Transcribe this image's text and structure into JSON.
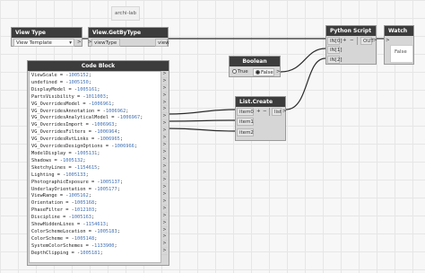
{
  "canvas_tag": "archi-lab",
  "nodes": {
    "view_type": {
      "title": "View Type",
      "value": "View Template",
      "dropdown_glyph": "▾",
      "out_glyph": ">"
    },
    "get_by_type": {
      "title": "View.GetByType",
      "in_port": "viewType",
      "out_port": "view",
      "in_glyph": ">"
    },
    "python": {
      "title": "Python Script",
      "in0": "IN[0]",
      "in1": "IN[1]",
      "in2": "IN[2]",
      "out": "OUT",
      "plus": "+",
      "minus": "−",
      "out_glyph": ">"
    },
    "watch": {
      "title": "Watch",
      "value": "False",
      "in_glyph": ">"
    },
    "boolean": {
      "title": "Boolean",
      "true_label": "True",
      "false_label": "False",
      "out_glyph": ">"
    },
    "list_create": {
      "title": "List.Create",
      "item0": "item0",
      "item1": "item1",
      "item2": "item2",
      "out": "list",
      "plus": "+",
      "minus": "−",
      "out_glyph": ">"
    },
    "code_block": {
      "title": "Code Block",
      "out_glyph": ">"
    }
  },
  "code_lines": [
    {
      "key": "ViewScale",
      "val": "1005152"
    },
    {
      "key": "undefined",
      "val": "1005150"
    },
    {
      "key": "DisplayModel",
      "val": "1005161"
    },
    {
      "key": "PartsVisibility",
      "val": "1011003"
    },
    {
      "key": "VG_OverridesModel",
      "val": "1006961"
    },
    {
      "key": "VG_OverridesAnnotation",
      "val": "1006962"
    },
    {
      "key": "VG_OverridesAnalyticalModel",
      "val": "1006967"
    },
    {
      "key": "VG_OverridesImport",
      "val": "1006963"
    },
    {
      "key": "VG_OverridesFilters",
      "val": "1006964"
    },
    {
      "key": "VG_OverridesRvtLinks",
      "val": "1006965"
    },
    {
      "key": "VG_OverridesDesignOptions",
      "val": "1006966"
    },
    {
      "key": "ModelDisplay",
      "val": "1005131"
    },
    {
      "key": "Shadows",
      "val": "1005132"
    },
    {
      "key": "SketchyLines",
      "val": "1154615"
    },
    {
      "key": "Lighting",
      "val": "1005133"
    },
    {
      "key": "PhotographicExposure",
      "val": "1005137"
    },
    {
      "key": "UnderlayOrientation",
      "val": "1005177"
    },
    {
      "key": "ViewRange",
      "val": "1005162"
    },
    {
      "key": "Orientation",
      "val": "1005168"
    },
    {
      "key": "PhaseFilter",
      "val": "1012103"
    },
    {
      "key": "Discipline",
      "val": "1005163"
    },
    {
      "key": "ShowHiddenLines",
      "val": "1154613"
    },
    {
      "key": "ColorSchemeLocation",
      "val": "1005183"
    },
    {
      "key": "ColorScheme",
      "val": "1005148"
    },
    {
      "key": "SystemColorSchemes",
      "val": "1133900"
    },
    {
      "key": "DepthClipping",
      "val": "1005181"
    }
  ],
  "colors": {
    "header": "#3c3c3c",
    "node_body": "#d6d6d6",
    "wire": "#2a2a2a",
    "code_value": "#3f6fb3"
  }
}
